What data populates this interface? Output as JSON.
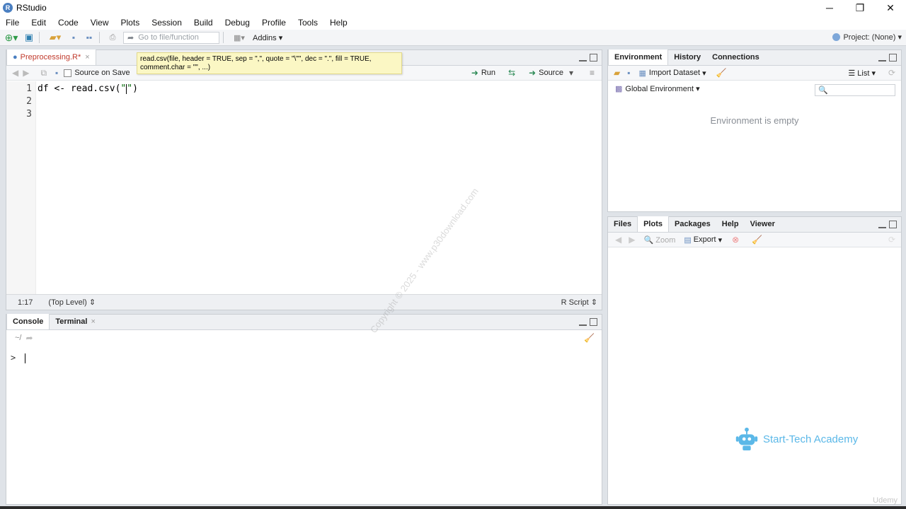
{
  "window": {
    "title": "RStudio",
    "controls": {
      "minimize": "─",
      "restore": "❐",
      "close": "✕"
    }
  },
  "menu": [
    "File",
    "Edit",
    "Code",
    "View",
    "Plots",
    "Session",
    "Build",
    "Debug",
    "Profile",
    "Tools",
    "Help"
  ],
  "toolbar": {
    "goto_placeholder": "Go to file/function",
    "addins_label": "Addins",
    "project_label": "Project: (None)"
  },
  "editor": {
    "tab_label": "Preprocessing.R*",
    "source_on_save_label": "Source on Save",
    "run_label": "Run",
    "source_label": "Source",
    "tooltip_line1": "read.csv(file, header = TRUE, sep = \",\", quote = \"\\\"\", dec = \".\", fill = TRUE,",
    "tooltip_line2": "comment.char = \"\", ...)",
    "line_numbers": [
      "1",
      "2",
      "3"
    ],
    "code_before": "df <- read.csv(",
    "code_str_open": "\"",
    "code_str_close": "\"",
    "code_after": ")",
    "status_position": "1:17",
    "status_scope": "(Top Level)",
    "status_filetype": "R Script"
  },
  "console": {
    "tab_console": "Console",
    "tab_terminal": "Terminal",
    "path": "~/",
    "prompt": ">"
  },
  "environment": {
    "tabs": [
      "Environment",
      "History",
      "Connections"
    ],
    "import_label": "Import Dataset",
    "list_label": "List",
    "scope_label": "Global Environment",
    "empty_message": "Environment is empty"
  },
  "files": {
    "tabs": [
      "Files",
      "Plots",
      "Packages",
      "Help",
      "Viewer"
    ],
    "zoom_label": "Zoom",
    "export_label": "Export"
  },
  "watermark": "Copyright © 2025 - www.p30download.com",
  "logo": {
    "text": "Start-Tech Academy"
  },
  "udemy": "Udemy",
  "colors": {
    "accent": "#4a7fc1",
    "run_green": "#2e8b57",
    "string_green": "#036a07",
    "logo_blue": "#5bb8e8"
  }
}
